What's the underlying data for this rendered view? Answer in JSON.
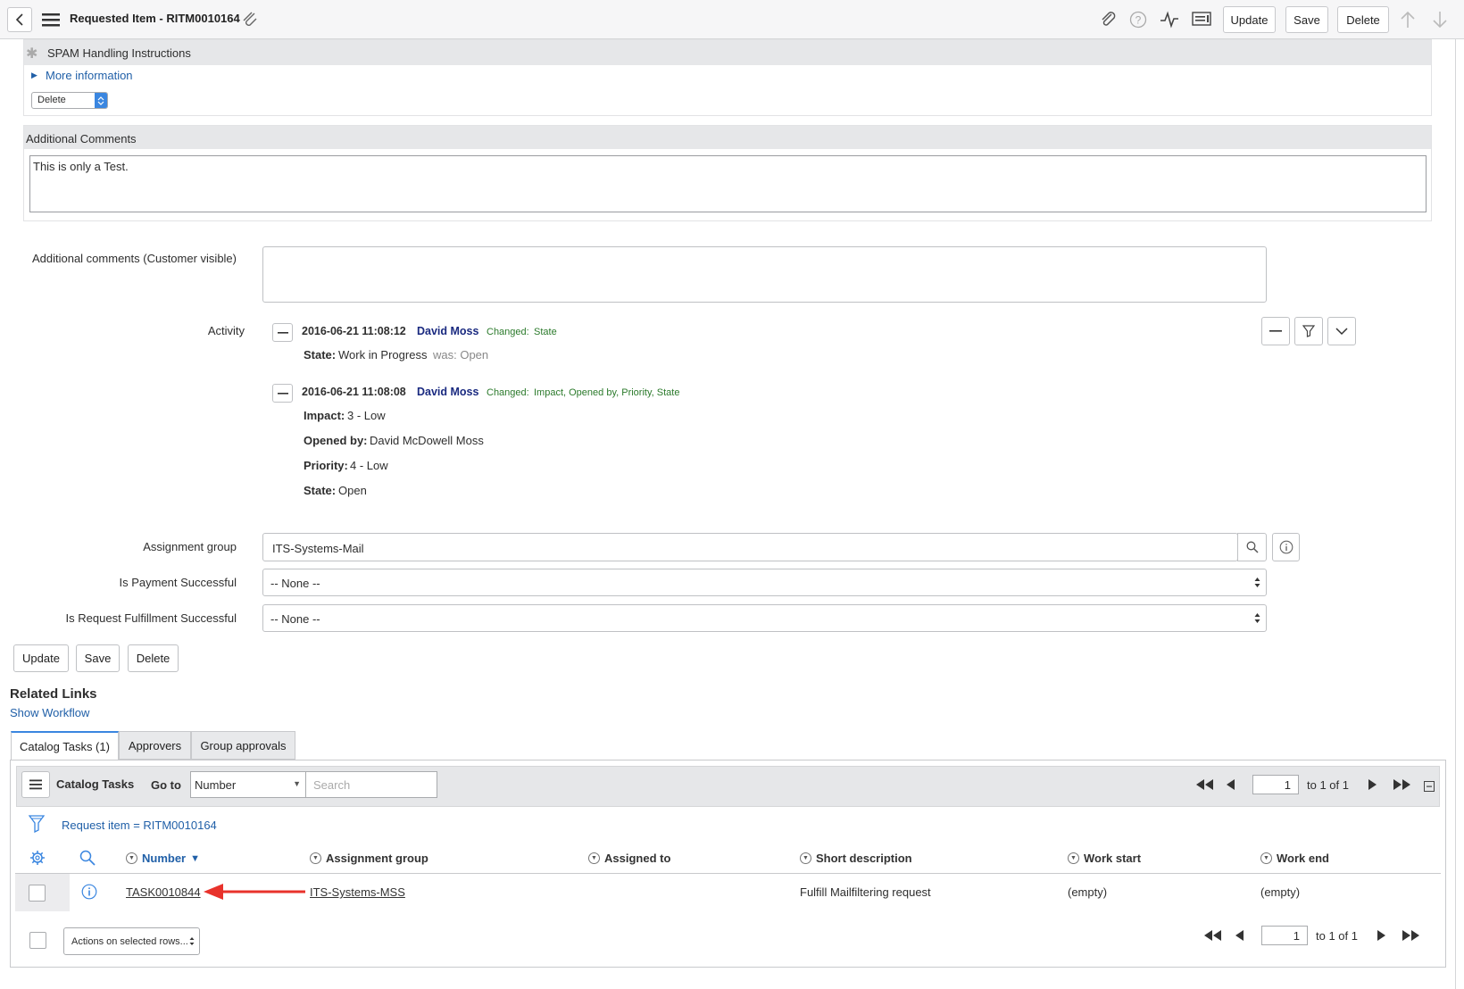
{
  "header": {
    "title": "Requested Item - RITM0010164",
    "buttons": {
      "update": "Update",
      "save": "Save",
      "delete": "Delete"
    }
  },
  "spam": {
    "label": "SPAM Handling Instructions",
    "more_info": "More information",
    "select_value": "Delete"
  },
  "additional_comments": {
    "label": "Additional Comments",
    "value": "This is only a Test."
  },
  "customer_comments": {
    "label": "Additional comments (Customer visible)"
  },
  "activity": {
    "label": "Activity",
    "entries": [
      {
        "timestamp": "2016-06-21 11:08:12",
        "user": "David Moss",
        "changed_label": "Changed:",
        "changed_fields": "State",
        "fields": [
          {
            "name": "State:",
            "value": "Work in Progress",
            "was": "was: Open"
          }
        ]
      },
      {
        "timestamp": "2016-06-21 11:08:08",
        "user": "David Moss",
        "changed_label": "Changed:",
        "changed_fields": "Impact, Opened by, Priority, State",
        "fields": [
          {
            "name": "Impact:",
            "value": "3 - Low"
          },
          {
            "name": "Opened by:",
            "value": "David McDowell Moss"
          },
          {
            "name": "Priority:",
            "value": "4 - Low"
          },
          {
            "name": "State:",
            "value": "Open"
          }
        ]
      }
    ]
  },
  "form": {
    "assignment_group": {
      "label": "Assignment group",
      "value": "ITS-Systems-Mail"
    },
    "payment": {
      "label": "Is Payment Successful",
      "value": "-- None --"
    },
    "fulfillment": {
      "label": "Is Request Fulfillment Successful",
      "value": "-- None --"
    },
    "buttons": {
      "update": "Update",
      "save": "Save",
      "delete": "Delete"
    }
  },
  "related_links": {
    "title": "Related Links",
    "show_workflow": "Show Workflow"
  },
  "tabs": [
    "Catalog Tasks (1)",
    "Approvers",
    "Group approvals"
  ],
  "list": {
    "title": "Catalog Tasks",
    "goto_label": "Go to",
    "goto_field": "Number",
    "search_placeholder": "Search",
    "page_value": "1",
    "page_text": "to 1 of 1",
    "filter_text": "Request item = RITM0010164",
    "columns": [
      "Number",
      "Assignment group",
      "Assigned to",
      "Short description",
      "Work start",
      "Work end"
    ],
    "rows": [
      {
        "number": "TASK0010844",
        "assignment_group": "ITS-Systems-MSS",
        "assigned_to": "",
        "short_description": "Fulfill Mailfiltering request",
        "work_start": "(empty)",
        "work_end": "(empty)"
      }
    ],
    "actions_label": "Actions on selected rows...",
    "bottom_page_value": "1",
    "bottom_page_text": "to 1 of 1"
  },
  "colors": {
    "accent": "#2160a8",
    "annotation_arrow": "#e8322b",
    "header_bg": "#f6f6f7",
    "changed_green": "#2b7a2b",
    "user_navy": "#1a2a80"
  }
}
